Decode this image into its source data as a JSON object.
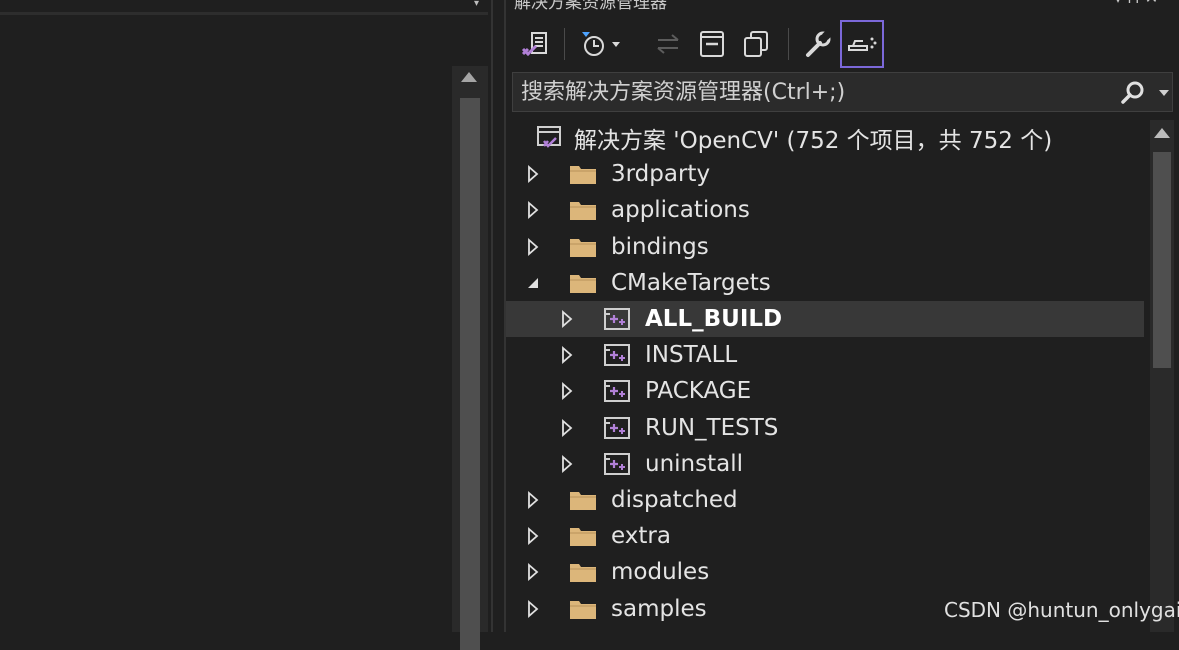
{
  "left_pane": {},
  "solution_explorer": {
    "title": "解决方案资源管理器",
    "title_controls": "▾ ⊓ ✕",
    "toolbar": [
      {
        "name": "vs-solution-switch-button",
        "icon": "vs-solution-icon"
      },
      {
        "name": "pending-changes-filter-button",
        "icon": "clock-filter-icon"
      },
      {
        "name": "sync-active-document-button",
        "icon": "sync-arrows-icon"
      },
      {
        "name": "collapse-all-button",
        "icon": "collapse-icon"
      },
      {
        "name": "show-all-files-button",
        "icon": "copy-icon"
      },
      {
        "name": "properties-button",
        "icon": "wrench-icon"
      },
      {
        "name": "preview-selected-button",
        "icon": "preview-icon"
      }
    ],
    "search": {
      "placeholder": "搜索解决方案资源管理器(Ctrl+;)"
    },
    "tree": [
      {
        "label": "解决方案 'OpenCV' (752 个项目，共 752 个)",
        "type": "solution",
        "level": 0,
        "expanded": null
      },
      {
        "label": "3rdparty",
        "type": "folder",
        "level": 1,
        "expanded": false
      },
      {
        "label": "applications",
        "type": "folder",
        "level": 1,
        "expanded": false
      },
      {
        "label": "bindings",
        "type": "folder",
        "level": 1,
        "expanded": false
      },
      {
        "label": "CMakeTargets",
        "type": "folder",
        "level": 1,
        "expanded": true
      },
      {
        "label": "ALL_BUILD",
        "type": "project",
        "level": 2,
        "expanded": false,
        "selected": true
      },
      {
        "label": "INSTALL",
        "type": "project",
        "level": 2,
        "expanded": false
      },
      {
        "label": "PACKAGE",
        "type": "project",
        "level": 2,
        "expanded": false
      },
      {
        "label": "RUN_TESTS",
        "type": "project",
        "level": 2,
        "expanded": false
      },
      {
        "label": "uninstall",
        "type": "project",
        "level": 2,
        "expanded": false
      },
      {
        "label": "dispatched",
        "type": "folder",
        "level": 1,
        "expanded": false
      },
      {
        "label": "extra",
        "type": "folder",
        "level": 1,
        "expanded": false
      },
      {
        "label": "modules",
        "type": "folder",
        "level": 1,
        "expanded": false
      },
      {
        "label": "samples",
        "type": "folder",
        "level": 1,
        "expanded": false
      }
    ]
  },
  "watermark": "CSDN @huntun_onlygai",
  "colors": {
    "background": "#1f1f1f",
    "folder": "#dcb67a",
    "accent": "#7b68d9",
    "vs_purple": "#b180d7"
  }
}
